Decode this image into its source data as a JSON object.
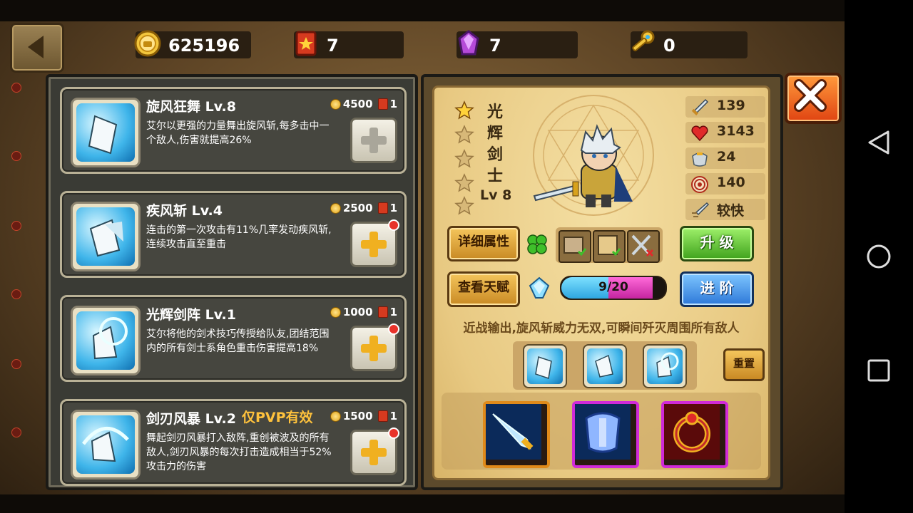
{
  "resources": {
    "gold": "625196",
    "red_book": "7",
    "gem": "7",
    "key": "0"
  },
  "skills": [
    {
      "name": "旋风狂舞 Lv.8",
      "pvp_tag": "",
      "cost_gold": "4500",
      "cost_book": "1",
      "desc": "艾尔以更强的力量舞出旋风斩,每多击中一个敌人,伤害就提高26%",
      "has_alert": false
    },
    {
      "name": "疾风斩 Lv.4",
      "pvp_tag": "",
      "cost_gold": "2500",
      "cost_book": "1",
      "desc": "连击的第一次攻击有11%几率发动疾风斩,连续攻击直至重击",
      "has_alert": true
    },
    {
      "name": "光辉剑阵 Lv.1",
      "pvp_tag": "",
      "cost_gold": "1000",
      "cost_book": "1",
      "desc": "艾尔将他的剑术技巧传授给队友,团结范围内的所有剑士系角色重击伤害提高18%",
      "has_alert": true
    },
    {
      "name": "剑刃风暴 Lv.2",
      "pvp_tag": "仅PVP有效",
      "cost_gold": "1500",
      "cost_book": "1",
      "desc": "舞起剑刃风暴打入敌阵,重创被波及的所有敌人,剑刃风暴的每次打击造成相当于52%攻击力的伤害",
      "has_alert": true
    }
  ],
  "hero": {
    "name_chars": [
      "光",
      "辉",
      "剑",
      "士"
    ],
    "level": "Lv 8",
    "stars_filled": 1,
    "stars_total": 5,
    "stats": [
      {
        "icon": "sword-icon",
        "value": "139"
      },
      {
        "icon": "heart-icon",
        "value": "3143"
      },
      {
        "icon": "armor-icon",
        "value": "24"
      },
      {
        "icon": "target-icon",
        "value": "140"
      },
      {
        "icon": "speed-icon",
        "value": "较快"
      }
    ],
    "tagline": "近战输出,旋风斩威力无双,可瞬间歼灭周围所有敌人",
    "talent_progress": {
      "text": "9/20",
      "current": 9,
      "max": 20
    }
  },
  "buttons": {
    "details": "详细属性",
    "talent": "查看天赋",
    "upgrade": "升 级",
    "advance": "进 阶",
    "reset": "重置"
  },
  "gear_items": [
    "blade-icon",
    "chest-armor-icon",
    "ring-icon"
  ],
  "colors": {
    "gold": "#e0a214",
    "alert_red": "#e8322a",
    "upgrade_green": "#3fa21c",
    "advance_blue": "#2d78d8",
    "pvp_orange": "#ffc23c"
  }
}
